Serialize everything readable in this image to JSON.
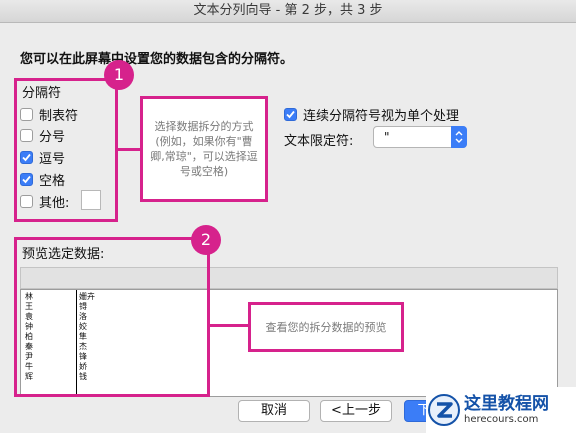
{
  "window": {
    "title": "文本分列向导 - 第 2 步，共 3 步"
  },
  "instruction": "您可以在此屏幕中设置您的数据包含的分隔符。",
  "delimiters": {
    "group_title": "分隔符",
    "items": [
      {
        "label": "制表符",
        "checked": false
      },
      {
        "label": "分号",
        "checked": false
      },
      {
        "label": "逗号",
        "checked": true
      },
      {
        "label": "空格",
        "checked": true
      },
      {
        "label": "其他:",
        "checked": false
      }
    ],
    "other_value": ""
  },
  "options": {
    "consecutive_label": "连续分隔符号视为单个处理",
    "consecutive_checked": true,
    "qualifier_label": "文本限定符:",
    "qualifier_value": "\""
  },
  "preview": {
    "label": "预览选定数据:",
    "col1": [
      "林",
      "王",
      "袁",
      "钟",
      "柏",
      "秦",
      "尹",
      "牛",
      "辉"
    ],
    "col2": [
      "姗卉",
      "锝",
      "洛",
      "姣",
      "隼",
      "杰",
      "锋",
      "娇",
      "钱"
    ]
  },
  "buttons": {
    "cancel": "取消",
    "back": "<上一步",
    "next": "下"
  },
  "annotations": {
    "badge1": "1",
    "badge2": "2",
    "note1": "选择数据拆分的方式(例如，如果你有\"曹卿,常琼\"，可以选择逗号或空格)",
    "note2": "查看您的拆分数据的预览"
  },
  "watermark": {
    "title": "这里教程网",
    "url": "herecours.com"
  },
  "colors": {
    "accent": "#3b7df7",
    "annotation": "#d6228c"
  }
}
